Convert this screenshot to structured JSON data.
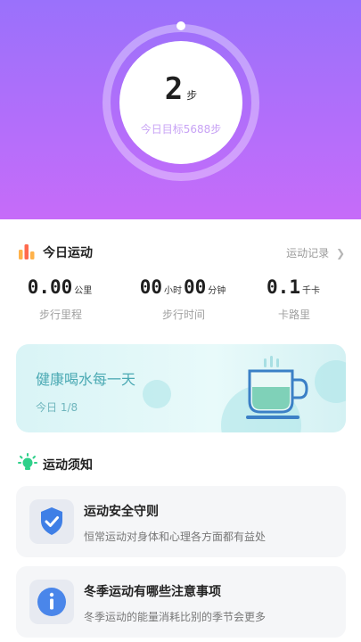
{
  "hero": {
    "steps": "2",
    "steps_unit": "步",
    "goal": "今日目标5688步"
  },
  "today": {
    "title": "今日运动",
    "record_link": "运动记录",
    "stats": [
      {
        "value": "0.00",
        "unit": "公里",
        "label": "步行里程"
      },
      {
        "hours": "00",
        "hours_unit": "小时",
        "minutes": "00",
        "minutes_unit": "分钟",
        "label": "步行时间"
      },
      {
        "value": "0.1",
        "unit": "千卡",
        "label": "卡路里"
      }
    ]
  },
  "water": {
    "title": "健康喝水每一天",
    "progress": "今日 1/8"
  },
  "tips": {
    "title": "运动须知",
    "cards": [
      {
        "title": "运动安全守则",
        "desc": "恒常运动对身体和心理各方面都有益处",
        "icon": "shield-check-icon"
      },
      {
        "title": "冬季运动有哪些注意事项",
        "desc": "冬季运动的能量消耗比别的季节会更多",
        "icon": "info-icon"
      }
    ]
  },
  "colors": {
    "hero_top": "#9a71fb",
    "hero_bottom": "#c66cf9",
    "accent_teal": "#4aa9b3"
  }
}
